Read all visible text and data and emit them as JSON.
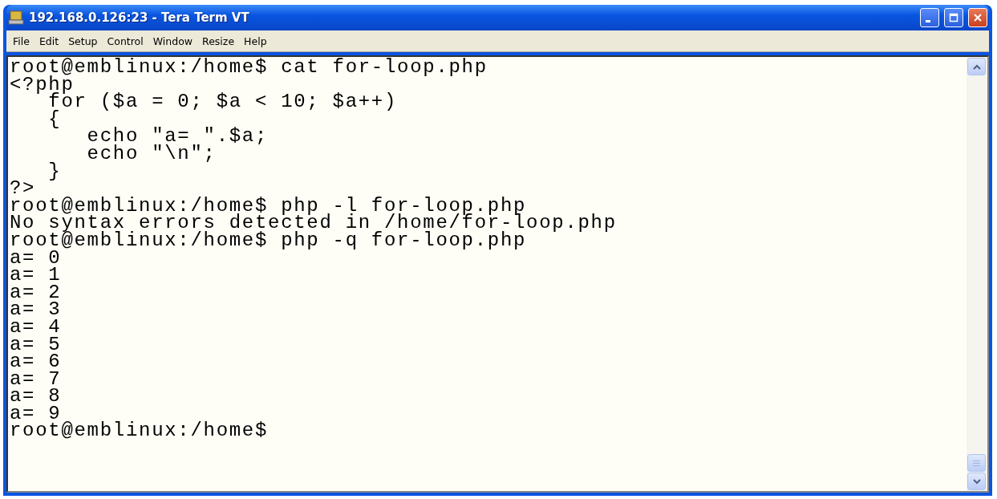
{
  "window": {
    "title": "192.168.0.126:23 - Tera Term VT"
  },
  "menu": [
    "File",
    "Edit",
    "Setup",
    "Control",
    "Window",
    "Resize",
    "Help"
  ],
  "terminal": {
    "lines": [
      "root@emblinux:/home$ cat for-loop.php",
      "<?php",
      "   for ($a = 0; $a < 10; $a++)",
      "   {",
      "      echo \"a= \".$a;",
      "      echo \"\\n\";",
      "   }",
      "?>",
      "root@emblinux:/home$ php -l for-loop.php",
      "No syntax errors detected in /home/for-loop.php",
      "root@emblinux:/home$ php -q for-loop.php",
      "a= 0",
      "a= 1",
      "a= 2",
      "a= 3",
      "a= 4",
      "a= 5",
      "a= 6",
      "a= 7",
      "a= 8",
      "a= 9",
      "root@emblinux:/home$"
    ]
  }
}
